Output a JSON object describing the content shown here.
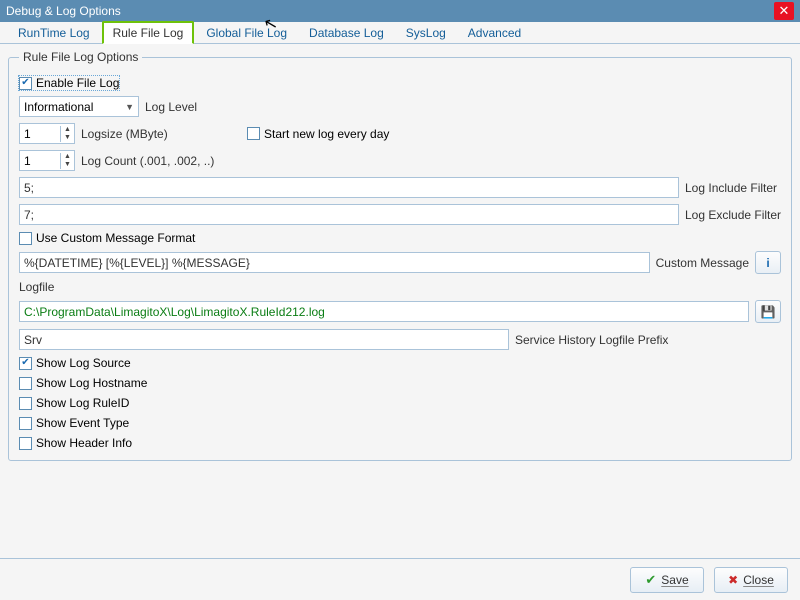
{
  "window": {
    "title": "Debug & Log Options"
  },
  "tabs": {
    "items": [
      "RunTime Log",
      "Rule File Log",
      "Global File Log",
      "Database Log",
      "SysLog",
      "Advanced"
    ],
    "active_index": 1
  },
  "group": {
    "legend": "Rule File Log Options"
  },
  "fields": {
    "enable_file_log": {
      "label": "Enable File Log",
      "checked": true
    },
    "log_level": {
      "value": "Informational",
      "label": "Log Level"
    },
    "logsize": {
      "value": "1",
      "label": "Logsize (MByte)"
    },
    "start_new_log": {
      "label": "Start new log every day",
      "checked": false
    },
    "log_count": {
      "value": "1",
      "label": "Log Count (.001, .002, ..)"
    },
    "include_filter": {
      "value": "5;",
      "label": "Log Include Filter"
    },
    "exclude_filter": {
      "value": "7;",
      "label": "Log Exclude Filter"
    },
    "use_custom_fmt": {
      "label": "Use Custom Message Format",
      "checked": false
    },
    "custom_message": {
      "value": "%{DATETIME} [%{LEVEL}] %{MESSAGE}",
      "label": "Custom Message"
    },
    "logfile_label": "Logfile",
    "logfile_path": "C:\\ProgramData\\LimagitoX\\Log\\LimagitoX.RuleId212.log",
    "service_prefix": {
      "value": "Srv",
      "label": "Service History Logfile Prefix"
    },
    "show_log_source": {
      "label": "Show Log Source",
      "checked": true
    },
    "show_log_hostname": {
      "label": "Show Log Hostname",
      "checked": false
    },
    "show_log_ruleid": {
      "label": "Show Log RuleID",
      "checked": false
    },
    "show_event_type": {
      "label": "Show Event Type",
      "checked": false
    },
    "show_header_info": {
      "label": "Show Header Info",
      "checked": false
    }
  },
  "buttons": {
    "save": "Save",
    "close": "Close"
  }
}
